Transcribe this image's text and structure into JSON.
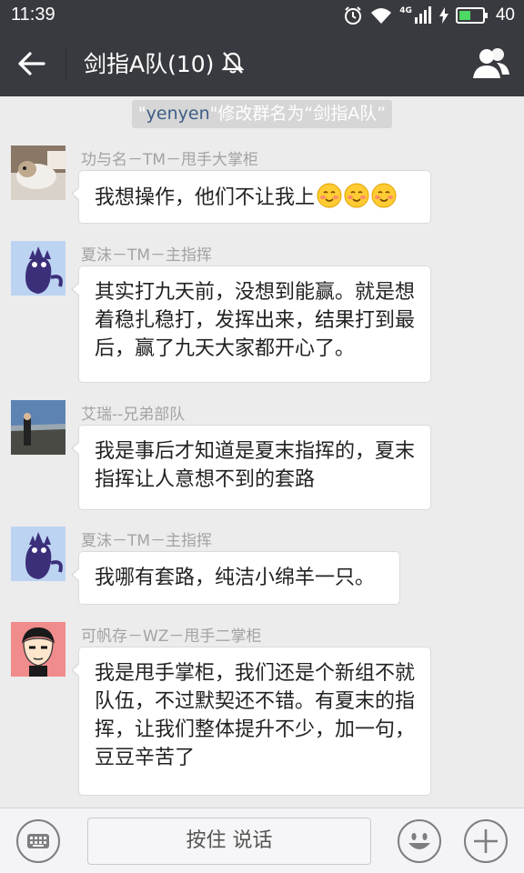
{
  "status_bar": {
    "time": "11:39",
    "network": "4G",
    "battery_level": "40"
  },
  "header": {
    "title": "剑指A队(10)",
    "back_icon": "arrow-left-icon",
    "mute_icon": "bell-off-icon",
    "members_icon": "group-members-icon"
  },
  "notice": {
    "quote_open": "\"",
    "name": "yenyen",
    "text": "\"修改群名为“剑指A队”"
  },
  "messages": [
    {
      "sender": "功与名－TM－甩手大掌柜",
      "text": "我想操作，他们不让我上",
      "emoji_count": 3
    },
    {
      "sender": "夏沫－TM－主指挥",
      "text": "其实打九天前，没想到能赢。就是想着稳扎稳打，发挥出来，结果打到最后，赢了九天大家都开心了。"
    },
    {
      "sender": "艾瑞--兄弟部队",
      "text": "我是事后才知道是夏末指挥的，夏末指挥让人意想不到的套路"
    },
    {
      "sender": "夏沫－TM－主指挥",
      "text": "我哪有套路，纯洁小绵羊一只。"
    },
    {
      "sender": "可帆存－WZ－甩手二掌柜",
      "text": "我是甩手掌柜，我们还是个新组不就队伍，不过默契还不错。有夏末的指挥，让我们整体提升不少，加一句，豆豆辛苦了"
    }
  ],
  "input_bar": {
    "hold_to_talk": "按住 说话",
    "keyboard_icon": "keyboard-icon",
    "emoji_icon": "smiley-icon",
    "plus_icon": "plus-icon"
  },
  "colors": {
    "header_bg": "#393a3f",
    "chat_bg": "#ececec",
    "bubble_bg": "#ffffff",
    "sender_text": "#a3a3a3"
  }
}
